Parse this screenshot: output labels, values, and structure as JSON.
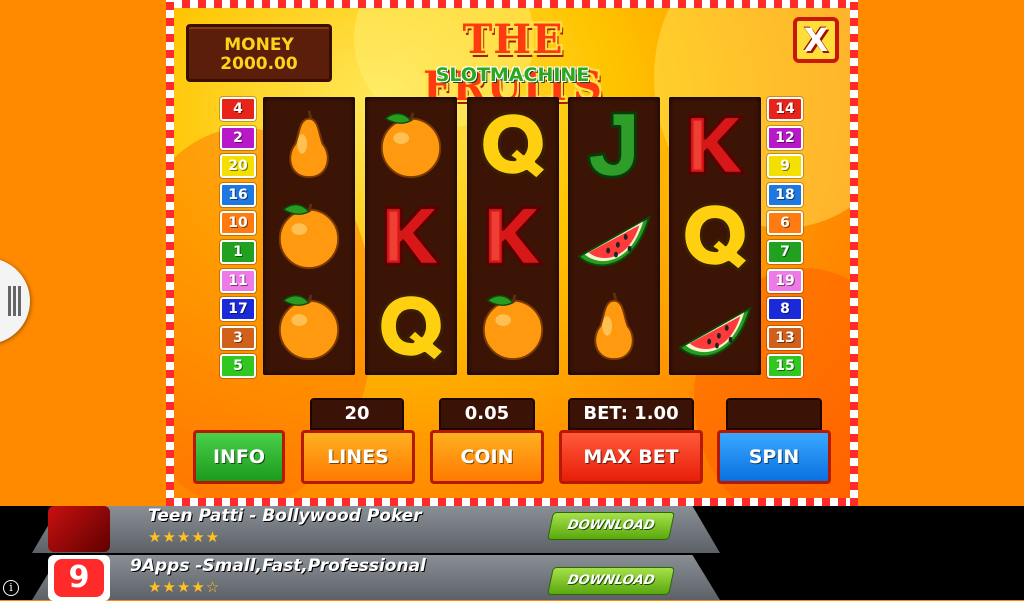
{
  "money": {
    "label": "MONEY",
    "value": "2000.00"
  },
  "title": "THE FRUITS",
  "subtitle": "SLOTMACHINE",
  "close_label": "X",
  "left_lines": [
    {
      "n": "4",
      "color": "#e8241a"
    },
    {
      "n": "2",
      "color": "#b818c8"
    },
    {
      "n": "20",
      "color": "#f4e000"
    },
    {
      "n": "16",
      "color": "#1e78e0"
    },
    {
      "n": "10",
      "color": "#ff7a10"
    },
    {
      "n": "1",
      "color": "#22a020"
    },
    {
      "n": "11",
      "color": "#ee7ae8"
    },
    {
      "n": "17",
      "color": "#1a2ad8"
    },
    {
      "n": "3",
      "color": "#d0601a"
    },
    {
      "n": "5",
      "color": "#30c820"
    }
  ],
  "right_lines": [
    {
      "n": "14",
      "color": "#e8241a"
    },
    {
      "n": "12",
      "color": "#b818c8"
    },
    {
      "n": "9",
      "color": "#f4e000"
    },
    {
      "n": "18",
      "color": "#1e78e0"
    },
    {
      "n": "6",
      "color": "#ff7a10"
    },
    {
      "n": "7",
      "color": "#22a020"
    },
    {
      "n": "19",
      "color": "#ee7ae8"
    },
    {
      "n": "8",
      "color": "#1a2ad8"
    },
    {
      "n": "13",
      "color": "#d0601a"
    },
    {
      "n": "15",
      "color": "#30c820"
    }
  ],
  "reels": [
    [
      "pear-icon",
      "orange-icon",
      "orange-icon"
    ],
    [
      "orange-icon",
      "k-symbol-icon",
      "q-symbol-icon"
    ],
    [
      "q-symbol-icon",
      "k-symbol-icon",
      "orange-icon"
    ],
    [
      "j-symbol-icon",
      "watermelon-icon",
      "pear-icon"
    ],
    [
      "k-symbol-icon",
      "q-symbol-icon",
      "watermelon-icon"
    ]
  ],
  "displays": {
    "lines": "20",
    "coin": "0.05",
    "bet": "BET: 1.00",
    "win": ""
  },
  "buttons": {
    "info": "INFO",
    "lines": "LINES",
    "coin": "COIN",
    "max_bet": "MAX BET",
    "spin": "SPIN"
  },
  "ads": [
    {
      "title": "Teen Patti - Bollywood Poker",
      "stars": "★★★★★",
      "download": "DOWNLOAD"
    },
    {
      "title": "9Apps -Small,Fast,Professional",
      "stars": "★★★★☆",
      "download": "DOWNLOAD"
    }
  ],
  "colors": {
    "info": "#2bb52b",
    "lines": "#ff8c00",
    "coin": "#ff8c00",
    "max_bet": "#ff3a1a",
    "spin": "#1e8ef0"
  }
}
